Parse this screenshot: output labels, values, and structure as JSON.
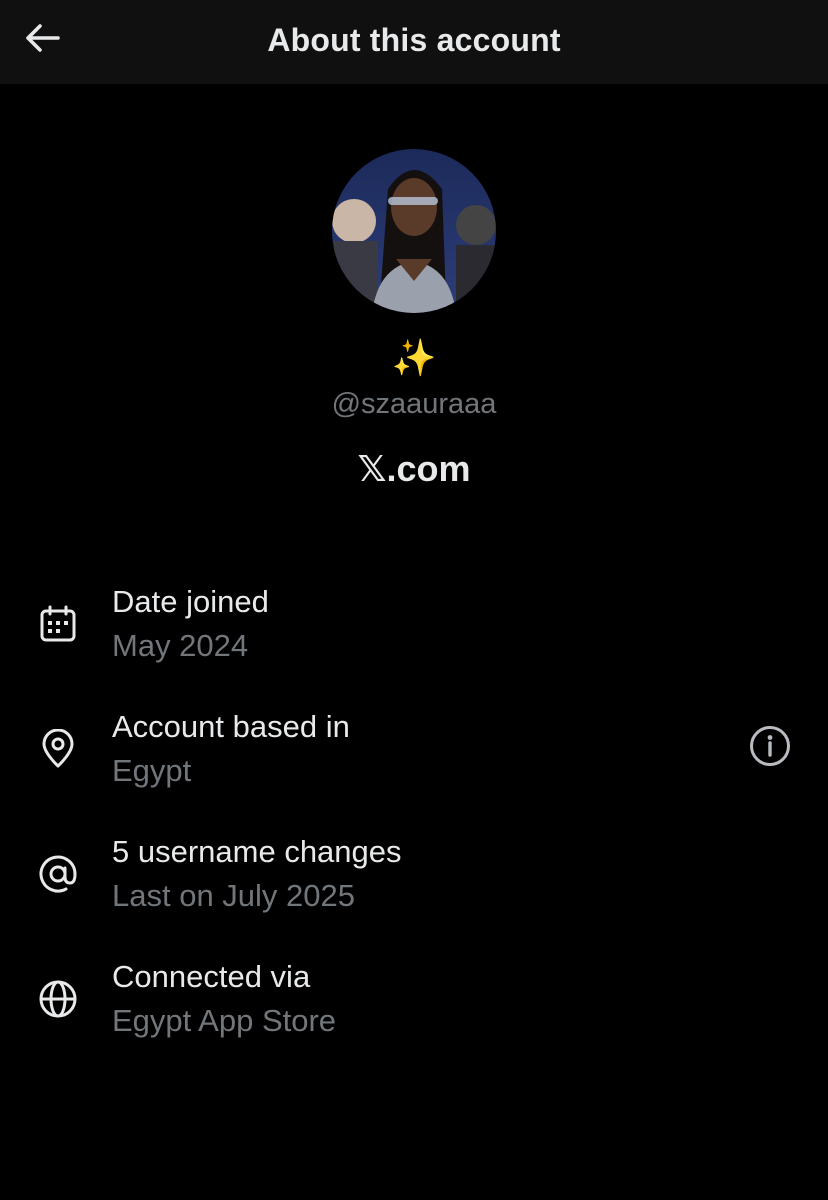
{
  "header": {
    "title": "About this account",
    "back_icon": "arrow-left-icon"
  },
  "profile": {
    "display_name": "✨",
    "handle": "@szaauraaa",
    "platform": "𝕏.com"
  },
  "details": [
    {
      "icon": "calendar-icon",
      "title": "Date joined",
      "subtitle": "May 2024"
    },
    {
      "icon": "location-pin-icon",
      "title": "Account based in",
      "subtitle": "Egypt",
      "extra_icon": "info-icon"
    },
    {
      "icon": "at-sign-icon",
      "title": "5 username changes",
      "subtitle": "Last on July 2025"
    },
    {
      "icon": "globe-icon",
      "title": "Connected via",
      "subtitle": "Egypt App Store"
    }
  ],
  "colors": {
    "background": "#000000",
    "header_bg": "#101010",
    "primary_text": "#e7e9ea",
    "secondary_text": "#71767b"
  }
}
